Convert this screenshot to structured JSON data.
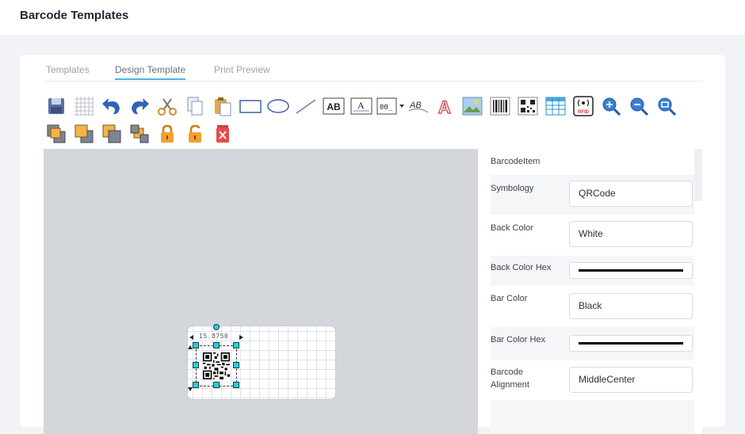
{
  "header": {
    "title": "Barcode Templates"
  },
  "tabs": [
    {
      "label": "Templates",
      "active": false
    },
    {
      "label": "Design Template",
      "active": true
    },
    {
      "label": "Print Preview",
      "active": false
    }
  ],
  "toolbar": {
    "row1": [
      "save-icon",
      "grid-icon",
      "undo-icon",
      "redo-icon",
      "cut-icon",
      "copy-icon",
      "paste-icon",
      "rectangle-icon",
      "ellipse-icon",
      "line-icon",
      "text-ab-icon",
      "text-box-icon",
      "numeric-text-icon",
      "warped-text-icon",
      "text-style-icon",
      "image-icon",
      "barcode-icon",
      "qrcode-icon",
      "table-icon",
      "rfid-icon",
      "zoom-in-icon",
      "zoom-out-icon",
      "zoom-fit-icon"
    ],
    "row2": [
      "bring-to-front-icon",
      "bring-forward-icon",
      "send-backward-icon",
      "send-to-back-icon",
      "lock-icon",
      "unlock-icon",
      "delete-icon"
    ],
    "rfid_text": "RFID",
    "text_icon_letters": "AB"
  },
  "canvas": {
    "dimension_label": "15.8750"
  },
  "properties": {
    "section_title": "BarcodeItem",
    "rows": [
      {
        "label": "Symbology",
        "value": "QRCode"
      },
      {
        "label": "Back Color",
        "value": "White"
      },
      {
        "label": "Back Color Hex",
        "color": "#000000"
      },
      {
        "label": "Bar Color",
        "value": "Black"
      },
      {
        "label": "Bar Color Hex",
        "color": "#000000"
      },
      {
        "label": "Barcode Alignment",
        "value": "MiddleCenter"
      }
    ]
  },
  "colors": {
    "accent": "#49b5e7",
    "handle": "#16d6e6",
    "canvas_bg": "#d3d6db"
  }
}
